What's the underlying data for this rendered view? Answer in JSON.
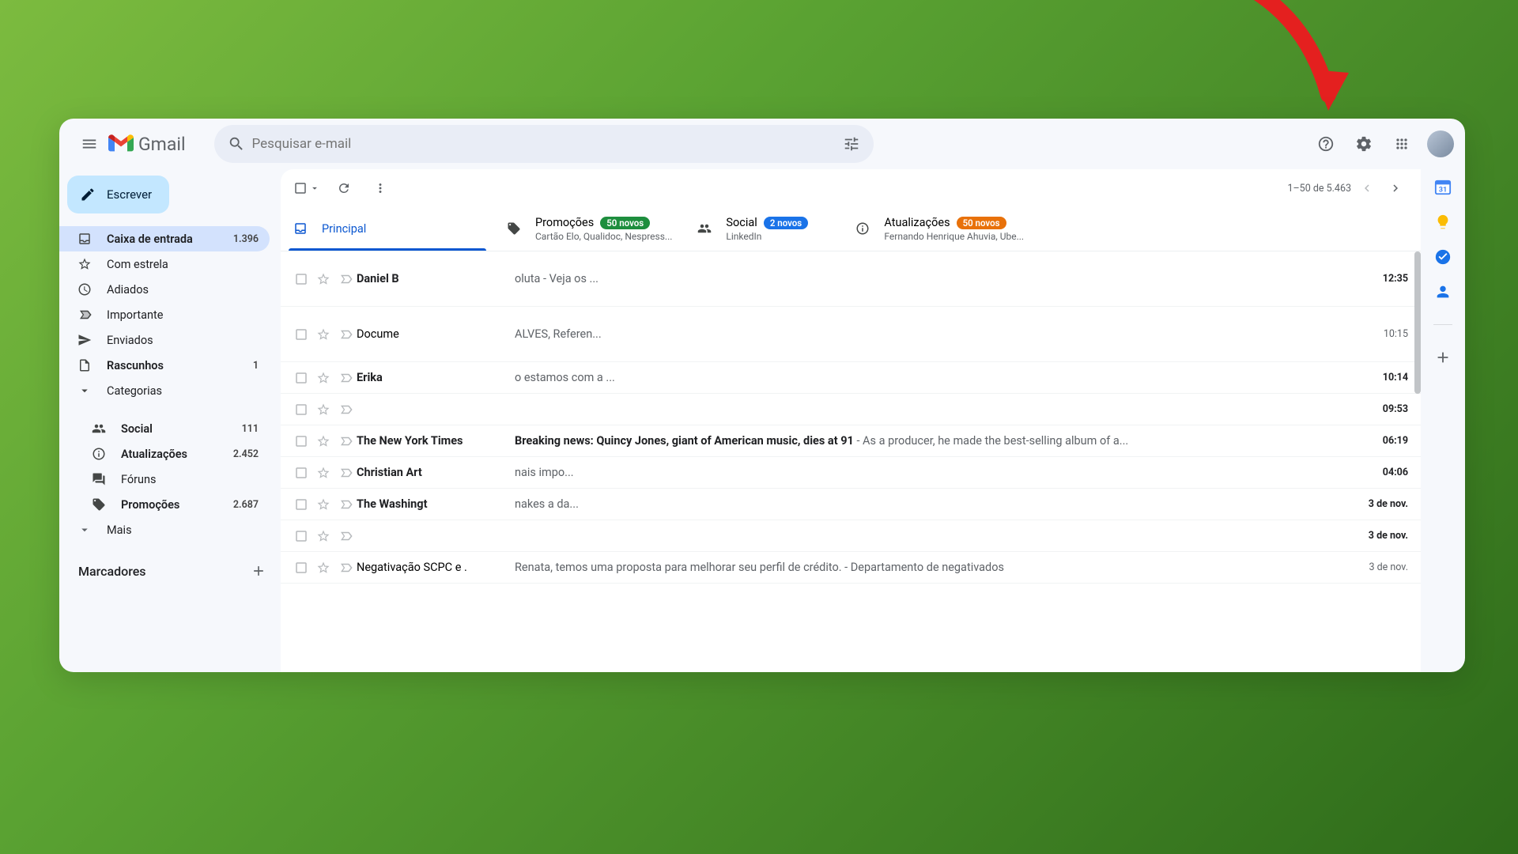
{
  "app": {
    "name": "Gmail"
  },
  "search": {
    "placeholder": "Pesquisar e-mail"
  },
  "compose": {
    "label": "Escrever"
  },
  "sidebar": {
    "items": [
      {
        "label": "Caixa de entrada",
        "count": "1.396",
        "active": true,
        "bold": true,
        "icon": "inbox"
      },
      {
        "label": "Com estrela",
        "count": "",
        "active": false,
        "bold": false,
        "icon": "star"
      },
      {
        "label": "Adiados",
        "count": "",
        "active": false,
        "bold": false,
        "icon": "clock"
      },
      {
        "label": "Importante",
        "count": "",
        "active": false,
        "bold": false,
        "icon": "important"
      },
      {
        "label": "Enviados",
        "count": "",
        "active": false,
        "bold": false,
        "icon": "send"
      },
      {
        "label": "Rascunhos",
        "count": "1",
        "active": false,
        "bold": true,
        "icon": "draft"
      },
      {
        "label": "Categorias",
        "count": "",
        "active": false,
        "bold": false,
        "icon": "expand"
      }
    ],
    "categories": [
      {
        "label": "Social",
        "count": "111",
        "bold": true,
        "icon": "people"
      },
      {
        "label": "Atualizações",
        "count": "2.452",
        "bold": true,
        "icon": "info"
      },
      {
        "label": "Fóruns",
        "count": "",
        "bold": false,
        "icon": "forum"
      },
      {
        "label": "Promoções",
        "count": "2.687",
        "bold": true,
        "icon": "tag"
      }
    ],
    "more": "Mais",
    "labels_header": "Marcadores"
  },
  "toolbar": {
    "page_range": "1–50 de 5.463"
  },
  "tabs": [
    {
      "label": "Principal",
      "badge": "",
      "badge_color": "",
      "sub": "",
      "icon": "inbox",
      "active": true
    },
    {
      "label": "Promoções",
      "badge": "50 novos",
      "badge_color": "green",
      "sub": "Cartão Elo, Qualidoc, Nespress...",
      "icon": "tag",
      "active": false
    },
    {
      "label": "Social",
      "badge": "2 novos",
      "badge_color": "blue",
      "sub": "LinkedIn",
      "icon": "people",
      "active": false
    },
    {
      "label": "Atualizações",
      "badge": "50 novos",
      "badge_color": "orange",
      "sub": "Fernando Henrique Ahuvia, Ube...",
      "icon": "info",
      "active": false
    }
  ],
  "emails": [
    {
      "sender": "Daniel B",
      "subject": "",
      "snippet": "oluta - Veja os ...",
      "time": "12:35",
      "unread": true,
      "tall": true
    },
    {
      "sender": "Docume",
      "subject": "",
      "snippet": "ALVES, Referen...",
      "time": "10:15",
      "unread": false,
      "tall": true
    },
    {
      "sender": "Erika",
      "subject": "",
      "snippet": "o estamos com a ...",
      "time": "10:14",
      "unread": true,
      "tall": false
    },
    {
      "sender": "",
      "subject": "",
      "snippet": "",
      "time": "09:53",
      "unread": true,
      "tall": false
    },
    {
      "sender": "The New York Times",
      "subject": "Breaking news: Quincy Jones, giant of American music, dies at 91",
      "snippet": " - As a producer, he made the best-selling album of a...",
      "time": "06:19",
      "unread": true,
      "tall": false
    },
    {
      "sender": "Christian Art",
      "subject": "",
      "snippet": "nais impo...",
      "time": "04:06",
      "unread": true,
      "tall": false
    },
    {
      "sender": "The Washingt",
      "subject": "",
      "snippet": "nakes a da...",
      "time": "3 de nov.",
      "unread": true,
      "tall": false
    },
    {
      "sender": "",
      "subject": "",
      "snippet": "",
      "time": "3 de nov.",
      "unread": true,
      "tall": false
    },
    {
      "sender": "Negativação SCPC e .",
      "subject": "Renata, temos uma proposta para melhorar seu perfil de crédito.",
      "snippet": " - Departamento de negativados",
      "time": "3 de nov.",
      "unread": false,
      "tall": false
    }
  ],
  "sidepanel": {
    "calendar_day": "31"
  }
}
